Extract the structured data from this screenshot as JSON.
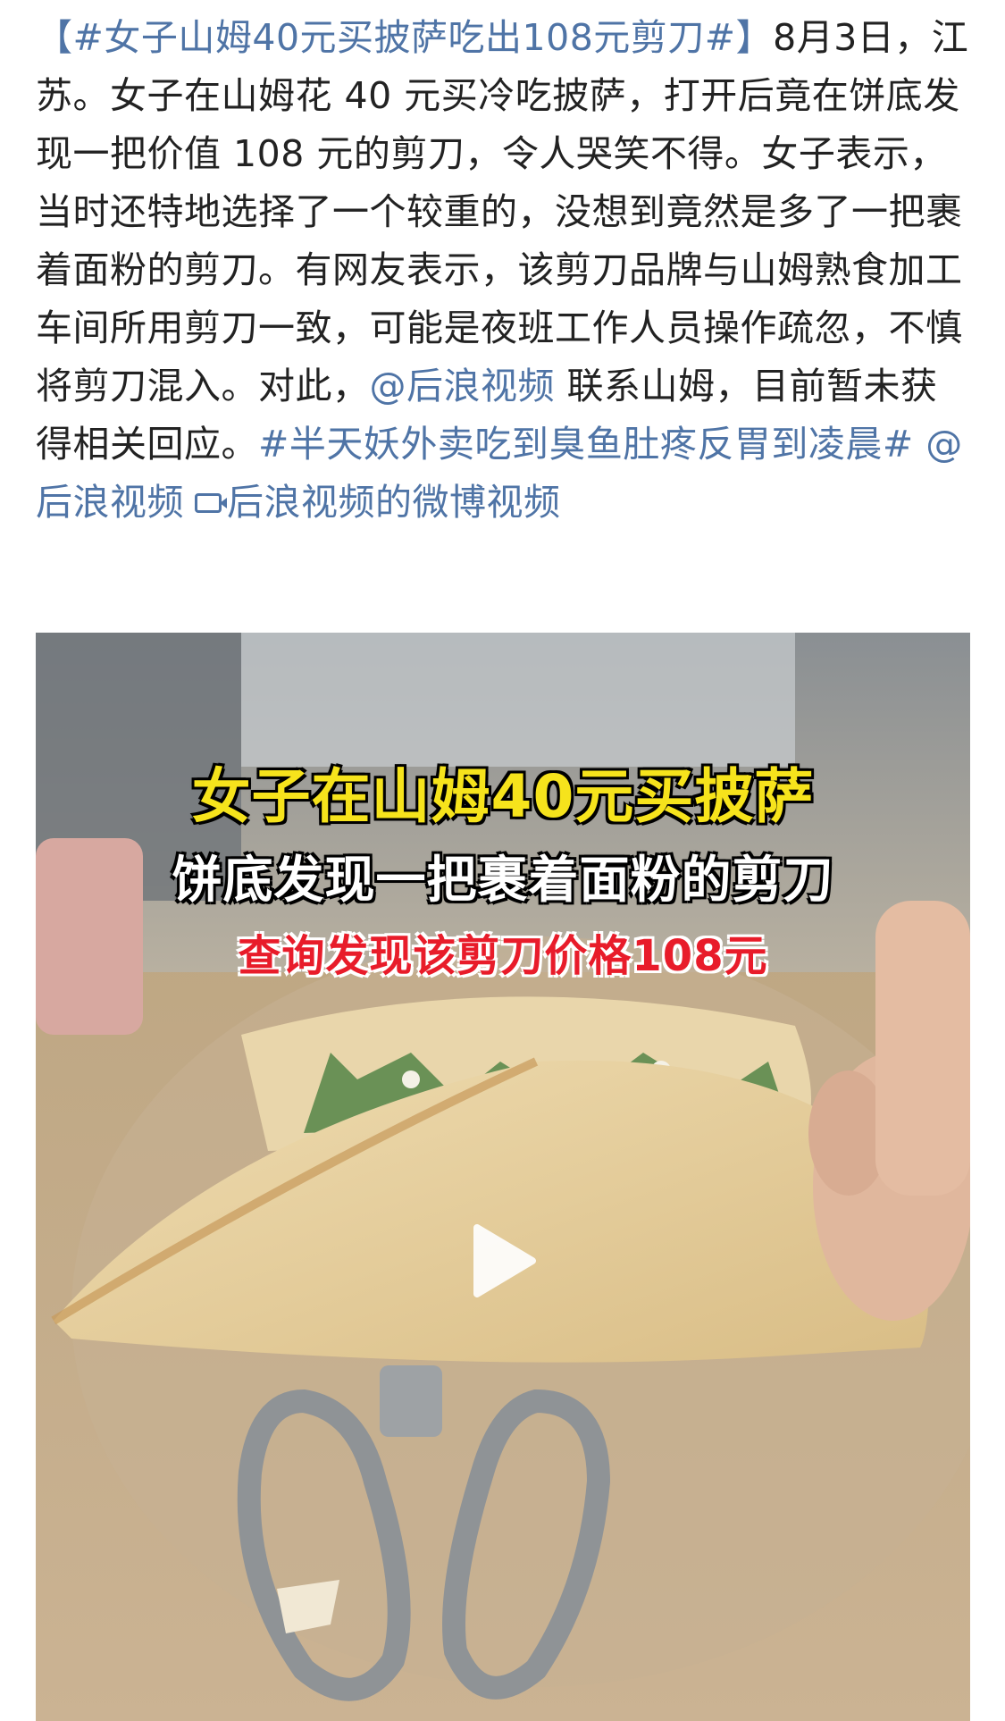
{
  "post": {
    "hashtag_1": "【#女子山姆40元买披萨吃出108元剪刀#】",
    "body_1": "8月3日，江苏。女子在山姆花 40 元买冷吃披萨，打开后竟在饼底发现一把价值 108 元的剪刀，令人哭笑不得。女子表示，当时还特地选择了一个较重的，没想到竟然是多了一把裹着面粉的剪刀。有网友表示，该剪刀品牌与山姆熟食加工车间所用剪刀一致，可能是夜班工作人员操作疏忽，不慎将剪刀混入。对此，",
    "mention_1": "@后浪视频",
    "body_2": " 联系山姆，目前暂未获得相关回应。",
    "hashtag_2": "#半天妖外卖吃到臭鱼肚疼反胃到凌晨#",
    "mention_2": " @后浪视频",
    "video_link": "后浪视频的微博视频"
  },
  "video": {
    "caption_1": "女子在山姆40元买披萨",
    "caption_2": "饼底发现一把裹着面粉的剪刀",
    "caption_3": "查询发现该剪刀价格108元"
  },
  "colors": {
    "link": "#4f74a6",
    "text": "#222222",
    "caption_yellow": "#f6e31c",
    "caption_red": "#e81c2a"
  },
  "icons": {
    "video": "video-camera-icon",
    "play": "play-icon"
  }
}
